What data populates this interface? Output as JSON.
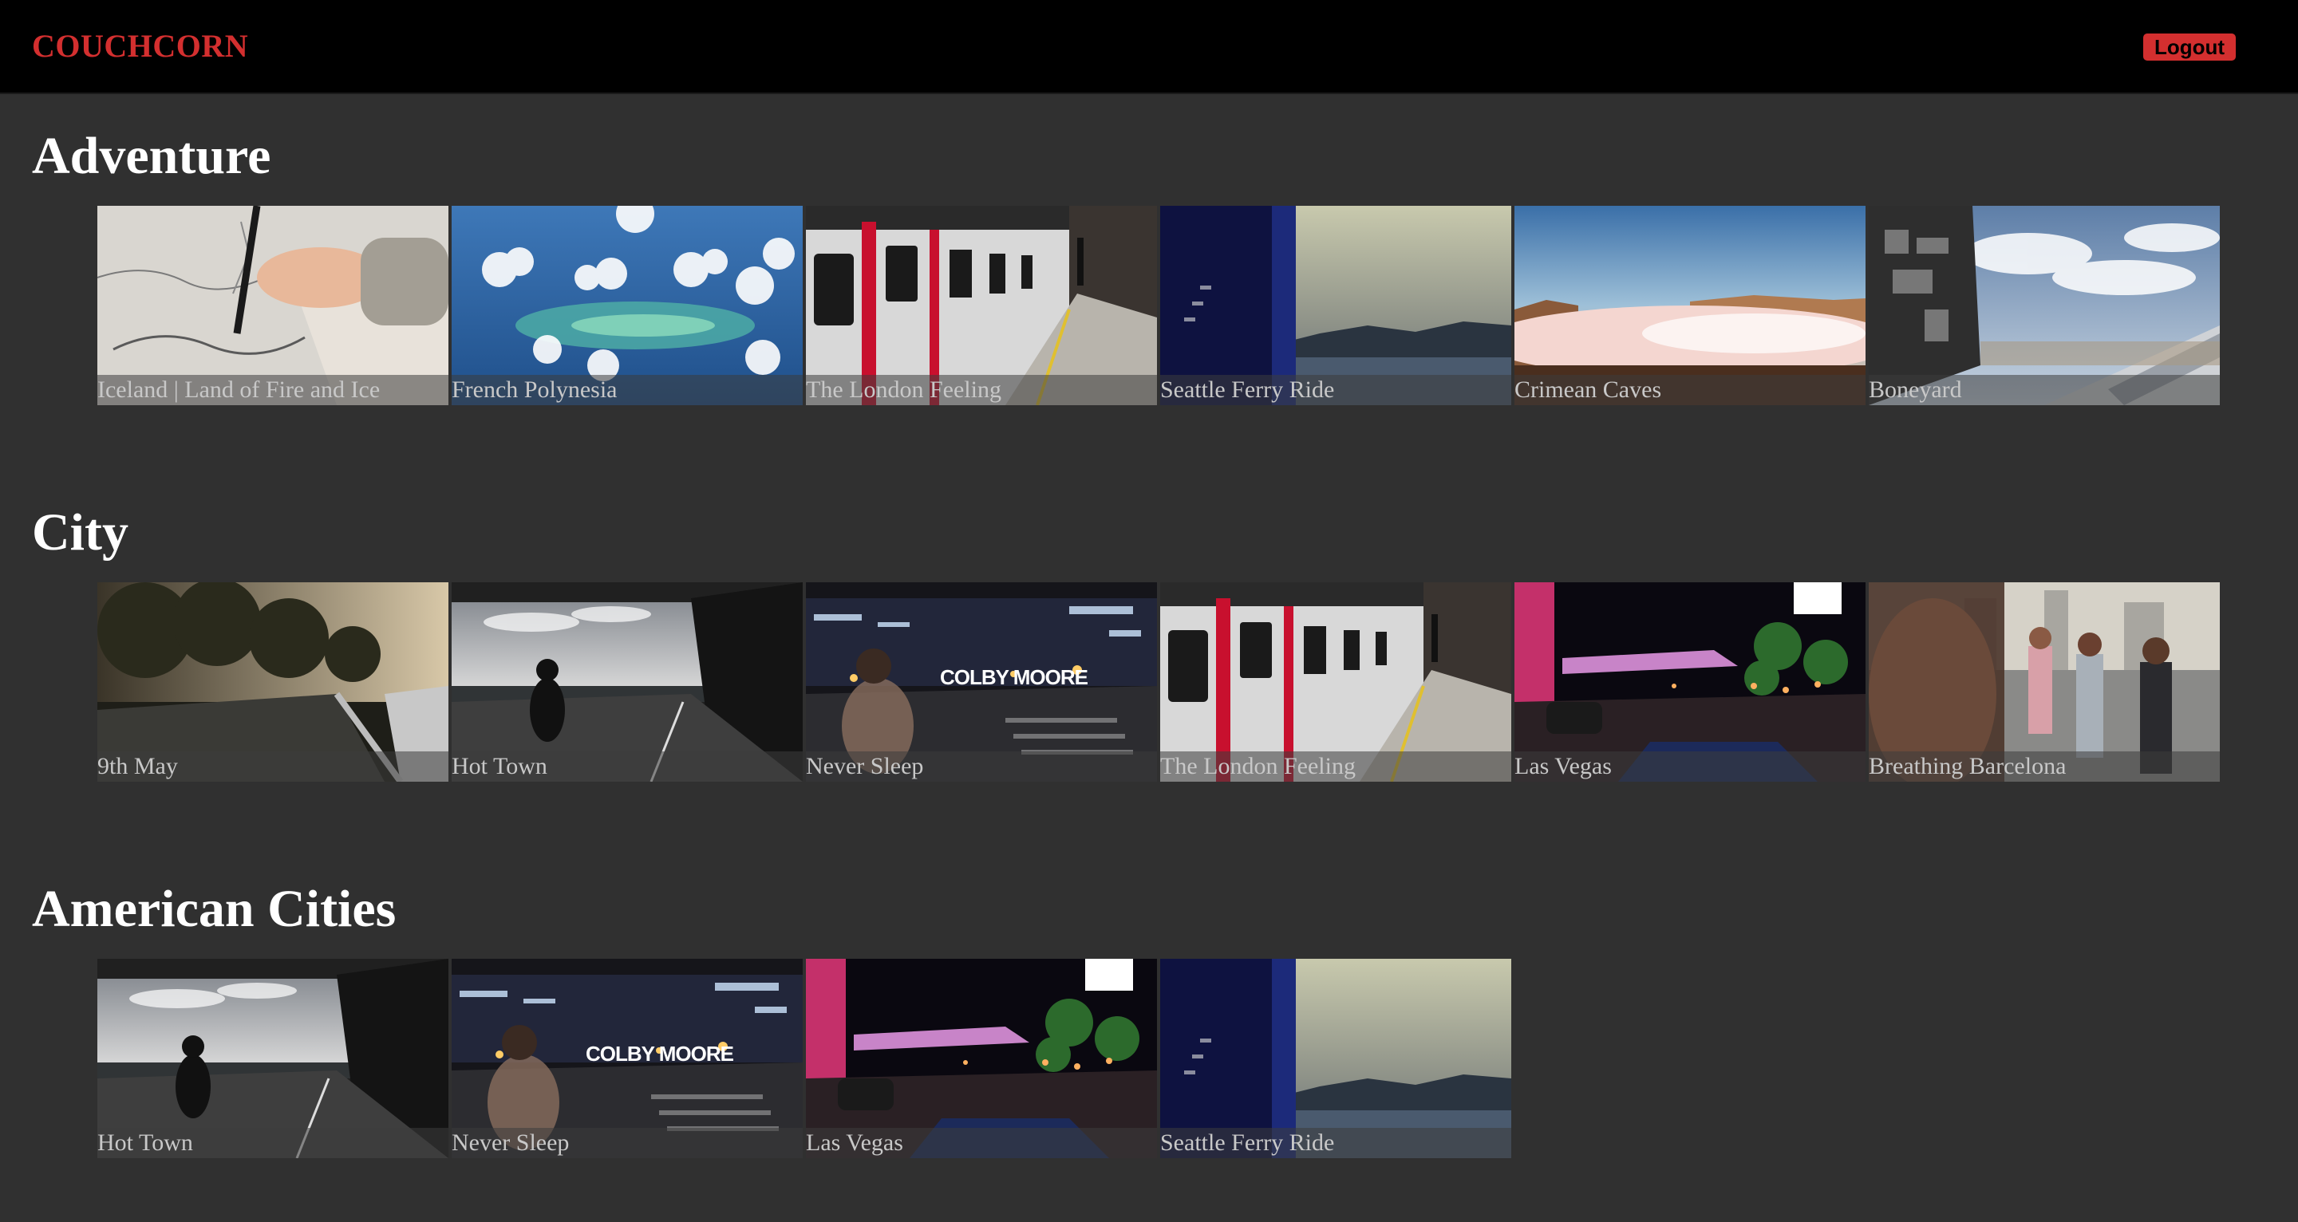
{
  "header": {
    "brand": "COUCHCORN",
    "logout_label": "Logout"
  },
  "colors": {
    "brand_red": "#d32f2f",
    "background": "#303030",
    "header_bg": "#000000"
  },
  "sections": [
    {
      "title": "Adventure",
      "items": [
        {
          "title": "Iceland | Land of Fire and Ice",
          "thumb": "map-drawing"
        },
        {
          "title": "French Polynesia",
          "thumb": "aerial-islands"
        },
        {
          "title": "The London Feeling",
          "thumb": "subway-train"
        },
        {
          "title": "Seattle Ferry Ride",
          "thumb": "ferry-window"
        },
        {
          "title": "Crimean Caves",
          "thumb": "cloud-canyon"
        },
        {
          "title": "Boneyard",
          "thumb": "plane-wreck"
        }
      ]
    },
    {
      "title": "City",
      "items": [
        {
          "title": "9th May",
          "thumb": "riverside-path"
        },
        {
          "title": "Hot Town",
          "thumb": "bike-street"
        },
        {
          "title": "Never Sleep",
          "thumb": "night-street",
          "overlay": "COLBY MOORE"
        },
        {
          "title": "The London Feeling",
          "thumb": "subway-train"
        },
        {
          "title": "Las Vegas",
          "thumb": "vegas-night"
        },
        {
          "title": "Breathing Barcelona",
          "thumb": "street-people"
        }
      ]
    },
    {
      "title": "American Cities",
      "items": [
        {
          "title": "Hot Town",
          "thumb": "bike-street"
        },
        {
          "title": "Never Sleep",
          "thumb": "night-street",
          "overlay": "COLBY MOORE"
        },
        {
          "title": "Las Vegas",
          "thumb": "vegas-night"
        },
        {
          "title": "Seattle Ferry Ride",
          "thumb": "ferry-window"
        }
      ]
    }
  ]
}
